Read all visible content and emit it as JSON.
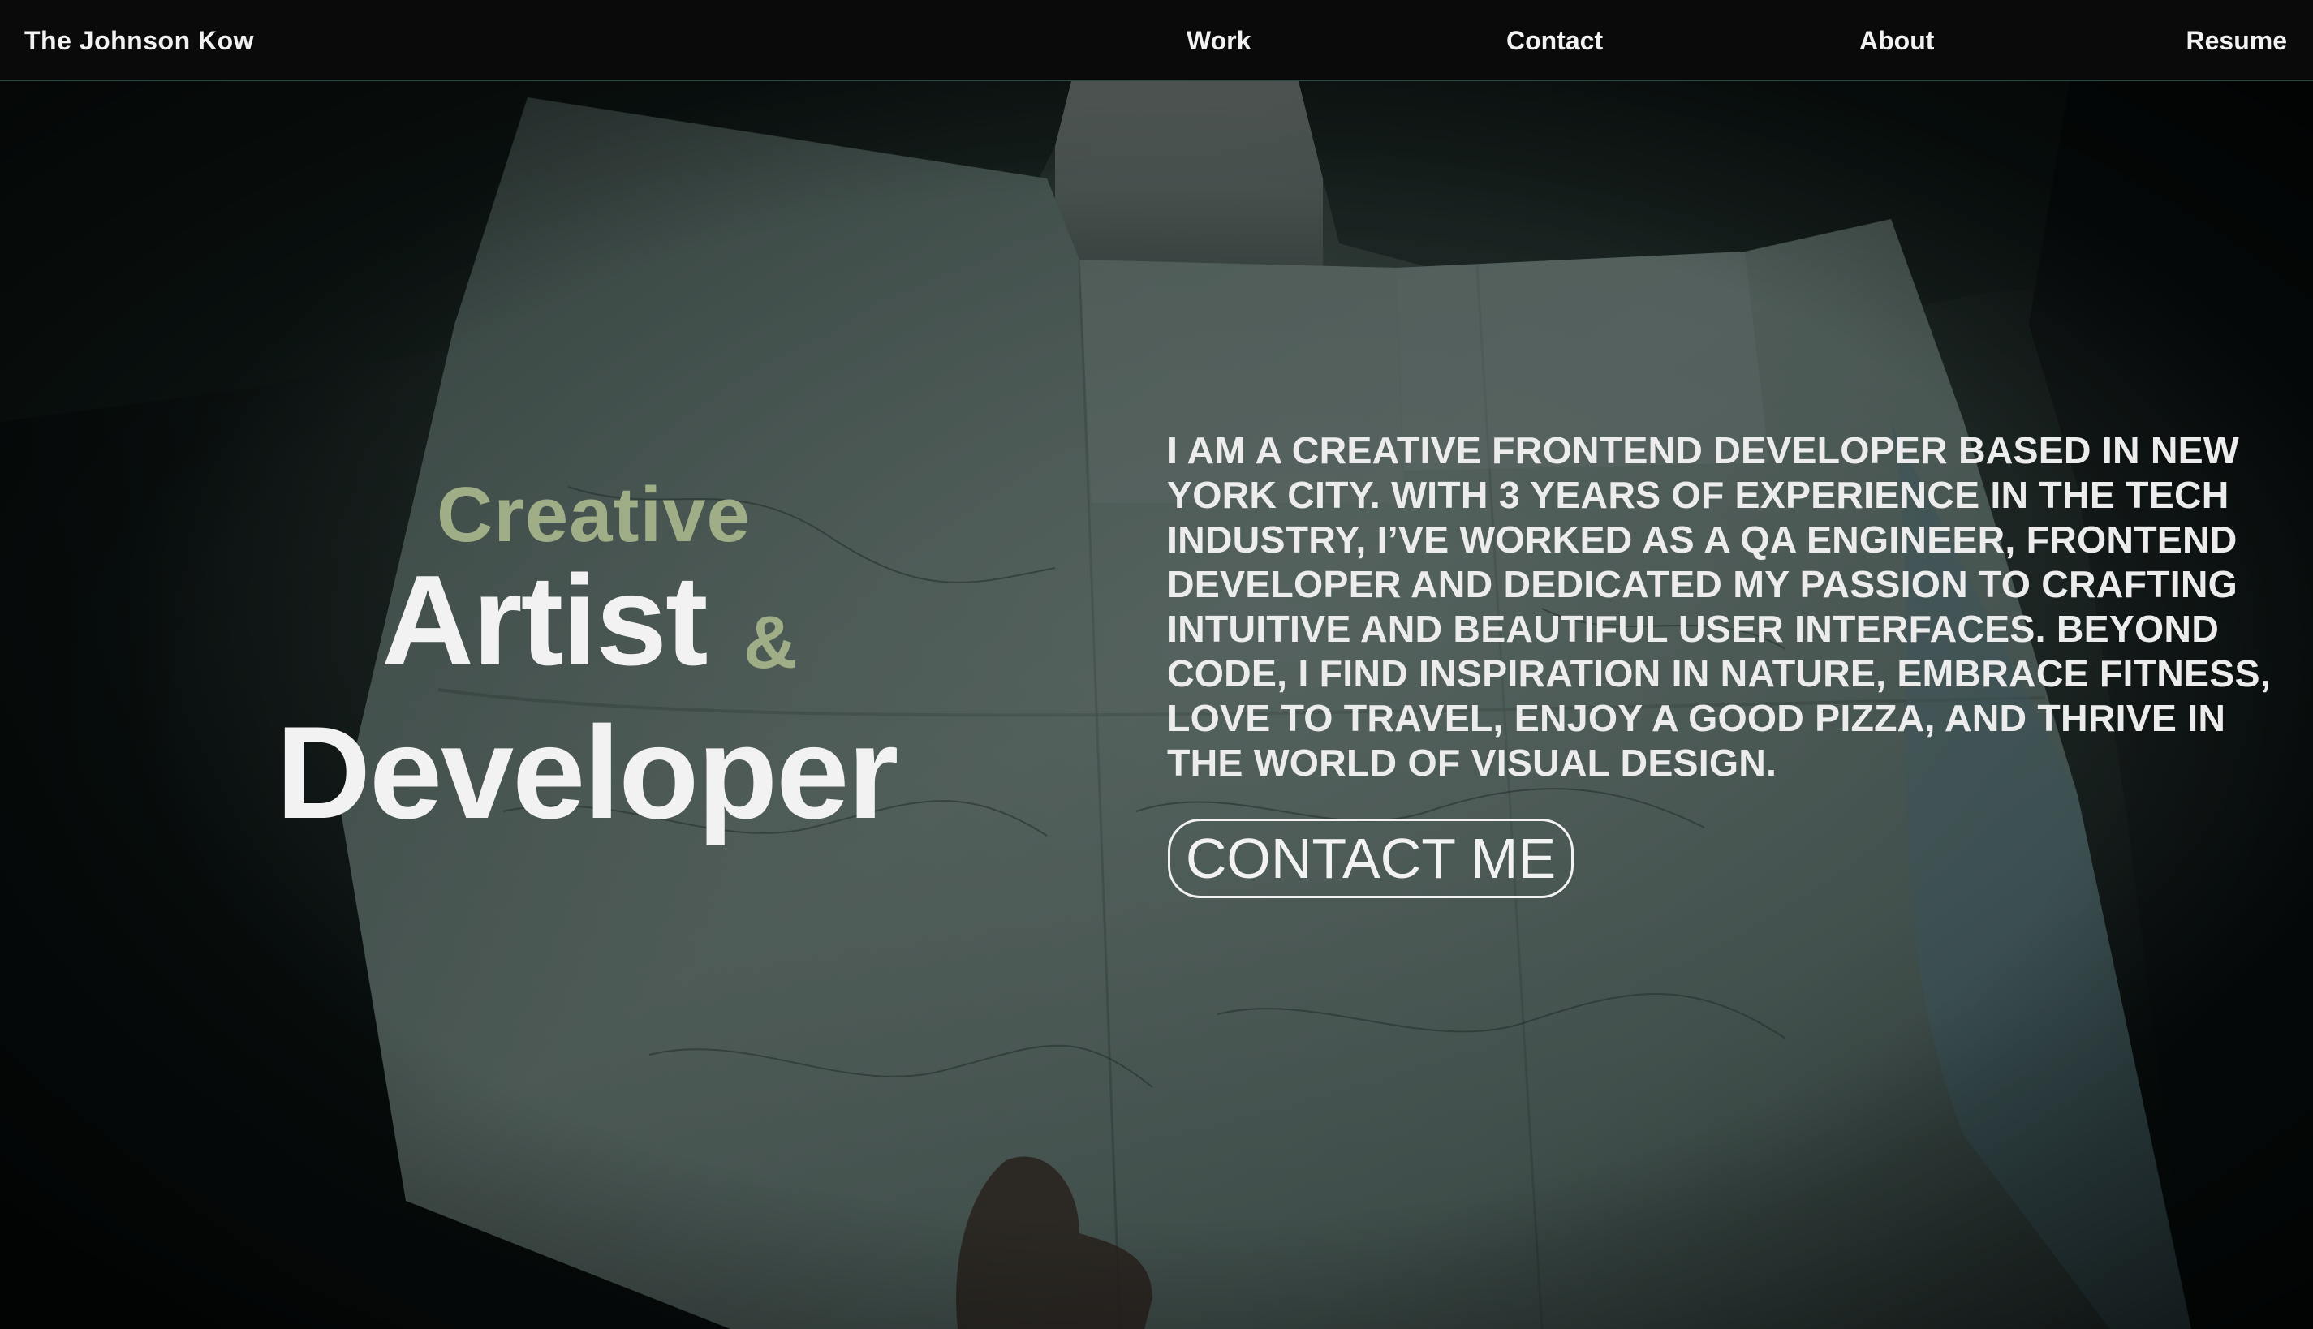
{
  "nav": {
    "brand": "The Johnson Kow",
    "links": [
      {
        "label": "Work"
      },
      {
        "label": "Contact"
      },
      {
        "label": "About"
      },
      {
        "label": "Resume"
      }
    ]
  },
  "hero": {
    "headline": {
      "line1": "Creative",
      "line2": "Artist",
      "ampersand": "&",
      "line3": "Developer"
    },
    "bio": "I am a creative frontend developer based in New York City. With 3 years of experience in the tech industry, I’ve worked as a QA Engineer, Frontend Developer and dedicated my passion to crafting intuitive and beautiful user interfaces. Beyond code, I find inspiration in nature, embrace fitness, love to travel, enjoy a good pizza, and thrive in the world of visual design.",
    "cta_label": "CONTACT ME",
    "background_image": "hands-holding-park-map-photo"
  },
  "colors": {
    "nav_background": "#0a0a0a",
    "accent_sage": "#9fae86",
    "text_light": "#f2f2f2"
  }
}
